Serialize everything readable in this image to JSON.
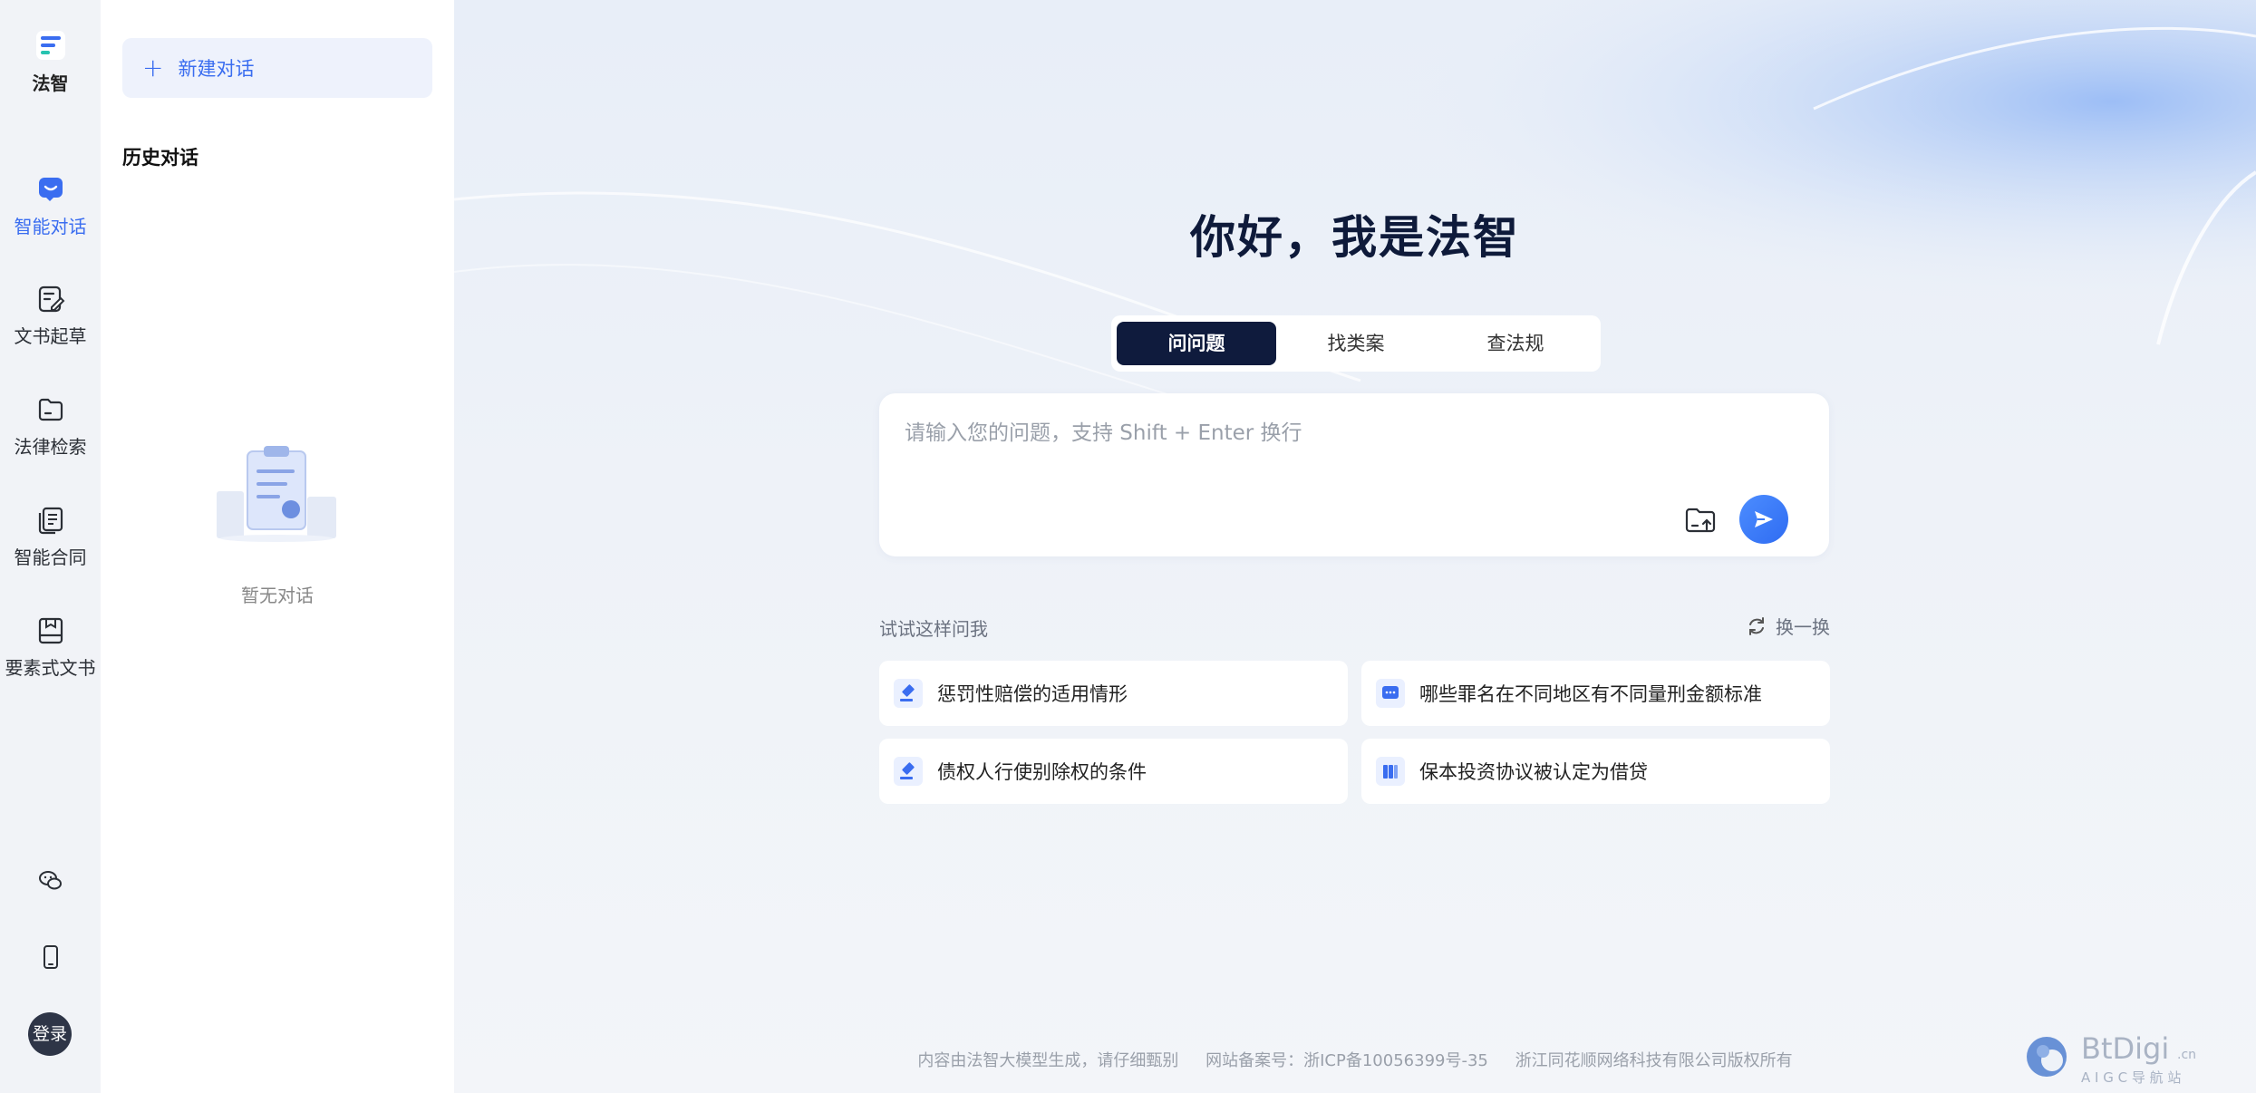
{
  "app": {
    "name": "法智"
  },
  "rail": {
    "items": [
      {
        "label": "智能对话",
        "icon": "chat-bubble-icon",
        "active": true
      },
      {
        "label": "文书起草",
        "icon": "edit-document-icon"
      },
      {
        "label": "法律检索",
        "icon": "folder-icon"
      },
      {
        "label": "智能合同",
        "icon": "contract-icon"
      },
      {
        "label": "要素式文书",
        "icon": "save-document-icon"
      }
    ],
    "bottom": [
      {
        "icon": "wechat-icon"
      },
      {
        "icon": "mobile-icon"
      }
    ],
    "login_label": "登录"
  },
  "panel": {
    "new_chat_label": "新建对话",
    "history_title": "历史对话",
    "empty_text": "暂无对话"
  },
  "main": {
    "greeting": "你好，我是法智",
    "tabs": [
      {
        "label": "问问题",
        "active": true
      },
      {
        "label": "找类案"
      },
      {
        "label": "查法规"
      }
    ],
    "input_placeholder": "请输入您的问题，支持 Shift + Enter 换行",
    "try_label": "试试这样问我",
    "refresh_label": "换一换",
    "suggestions": [
      {
        "text": "惩罚性赔偿的适用情形",
        "icon": "gavel-icon"
      },
      {
        "text": "哪些罪名在不同地区有不同量刑金额标准",
        "icon": "message-icon"
      },
      {
        "text": "债权人行使别除权的条件",
        "icon": "gavel-icon"
      },
      {
        "text": "保本投资协议被认定为借贷",
        "icon": "books-icon"
      }
    ]
  },
  "footer": {
    "disclaimer": "内容由法智大模型生成，请仔细甄别",
    "icp": "网站备案号：浙ICP备10056399号-35",
    "copyright": "浙江同花顺网络科技有限公司版权所有"
  },
  "watermark": {
    "brand": "BtDigi",
    "tld": ".cn",
    "tagline": "A I G C 导 航 站"
  },
  "colors": {
    "accent": "#3a6df0",
    "tab_active": "#0f1b3d",
    "rail_bg": "#f1f3f7"
  }
}
